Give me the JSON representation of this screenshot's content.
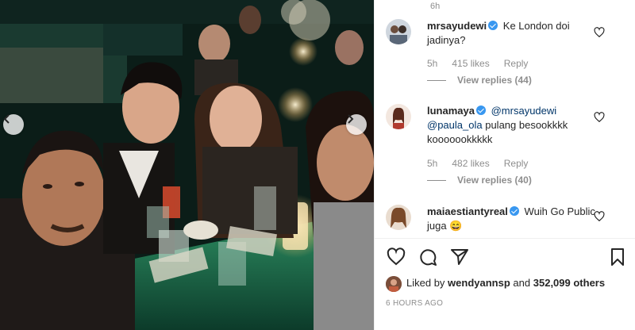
{
  "post": {
    "time_ago_top": "6h",
    "likes_line": {
      "prefix": "Liked by",
      "user": "wendyannsp",
      "conj": "and",
      "count": "352,099 others"
    },
    "posted": "6 HOURS AGO"
  },
  "comments": [
    {
      "username": "mrsayudewi",
      "verified": true,
      "text": "Ke London doi jadinya?",
      "time": "5h",
      "likes": "415 likes",
      "reply_label": "Reply",
      "view_replies": "View replies (44)"
    },
    {
      "username": "lunamaya",
      "verified": true,
      "mention1": "@mrsayudewi",
      "mention2": "@paula_ola",
      "text": "pulang besookkkk kooooookkkkk",
      "time": "5h",
      "likes": "482 likes",
      "reply_label": "Reply",
      "view_replies": "View replies (40)"
    },
    {
      "username": "maiaestiantyreal",
      "verified": true,
      "text": "Wuih Go Public juga",
      "emoji": "😄"
    }
  ],
  "icons": {
    "like": "heart-icon",
    "comment": "comment-icon",
    "share": "paper-plane-icon",
    "save": "bookmark-icon",
    "prev": "chevron-left-icon",
    "next": "chevron-right-icon"
  },
  "colors": {
    "verified": "#3897f0",
    "mention": "#003569",
    "muted": "#8e8e8e"
  }
}
